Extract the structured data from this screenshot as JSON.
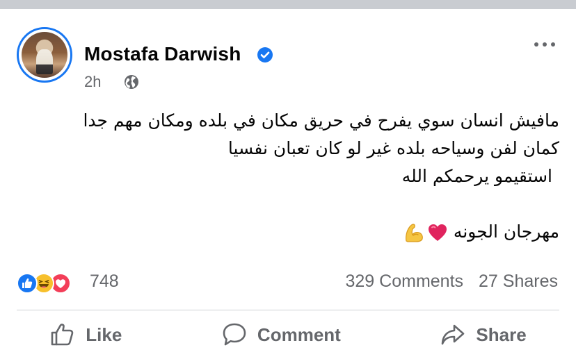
{
  "post": {
    "author": "Mostafa Darwish",
    "time": "2h",
    "lines": [
      "مافيش انسان سوي يفرح في حريق مكان في بلده ومكان مهم جدا",
      "كمان لفن وسياحه بلده غير لو كان تعبان نفسيا",
      "استقيمو يرحمكم الله",
      "مهرجان الجونه"
    ],
    "emojis": [
      "red-heart",
      "flexed-biceps"
    ]
  },
  "engagement": {
    "reaction_count": "748",
    "comments": "329 Comments",
    "shares": "27 Shares",
    "reaction_icons": [
      "like-reaction-icon",
      "haha-reaction-icon",
      "love-reaction-icon"
    ]
  },
  "actions": {
    "like": "Like",
    "comment": "Comment",
    "share": "Share"
  },
  "colors": {
    "accent": "#1877f2",
    "text": "#050505",
    "muted": "#65676b",
    "divider": "#ced0d4",
    "love": "#f33e58",
    "haha": "#f7c02c"
  }
}
